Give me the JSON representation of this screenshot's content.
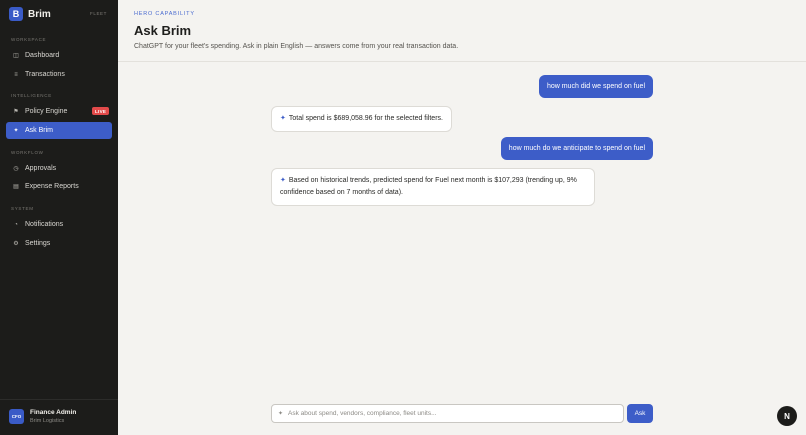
{
  "brand": {
    "logo_letter": "B",
    "name": "Brim",
    "tag": "FLEET"
  },
  "sidebar": {
    "sections": [
      {
        "label": "WORKSPACE"
      },
      {
        "label": "INTELLIGENCE"
      },
      {
        "label": "WORKFLOW"
      },
      {
        "label": "SYSTEM"
      }
    ],
    "items": [
      {
        "label": "Dashboard",
        "icon": "grid-icon",
        "glyph": "◫"
      },
      {
        "label": "Transactions",
        "icon": "list-icon",
        "glyph": "≡"
      },
      {
        "label": "Policy Engine",
        "icon": "flag-icon",
        "glyph": "⚑",
        "badge": "LIVE"
      },
      {
        "label": "Ask Brim",
        "icon": "sparkle-icon",
        "glyph": "✦",
        "active": true
      },
      {
        "label": "Approvals",
        "icon": "check-circle-icon",
        "glyph": "◷"
      },
      {
        "label": "Expense Reports",
        "icon": "document-icon",
        "glyph": "▤"
      },
      {
        "label": "Notifications",
        "icon": "bell-icon",
        "glyph": "◔"
      },
      {
        "label": "Settings",
        "icon": "gear-icon",
        "glyph": "⚙"
      }
    ]
  },
  "user": {
    "initials": "CFO",
    "name": "Finance Admin",
    "org": "Brim Logistics"
  },
  "header": {
    "eyebrow": "HERO CAPABILITY",
    "title": "Ask Brim",
    "subtitle": "ChatGPT for your fleet's spending. Ask in plain English — answers come from your real transaction data."
  },
  "chat": {
    "messages": [
      {
        "role": "user",
        "text": "how much did we spend on fuel"
      },
      {
        "role": "assistant",
        "text": "Total spend is $689,058.96 for the selected filters."
      },
      {
        "role": "user",
        "text": "how much do we anticipate to spend on fuel"
      },
      {
        "role": "assistant",
        "text": "Based on historical trends, predicted spend for Fuel next month is $107,293 (trending up, 9% confidence based on 7 months of data)."
      }
    ]
  },
  "composer": {
    "placeholder": "Ask about spend, vendors, compliance, fleet units...",
    "value": "",
    "button_label": "Ask"
  },
  "fab": {
    "label": "N"
  },
  "colors": {
    "accent": "#3d5dc8",
    "sidebar_bg": "#1c1c1a",
    "badge_red": "#e24a4a",
    "page_bg": "#f4f3f0"
  }
}
